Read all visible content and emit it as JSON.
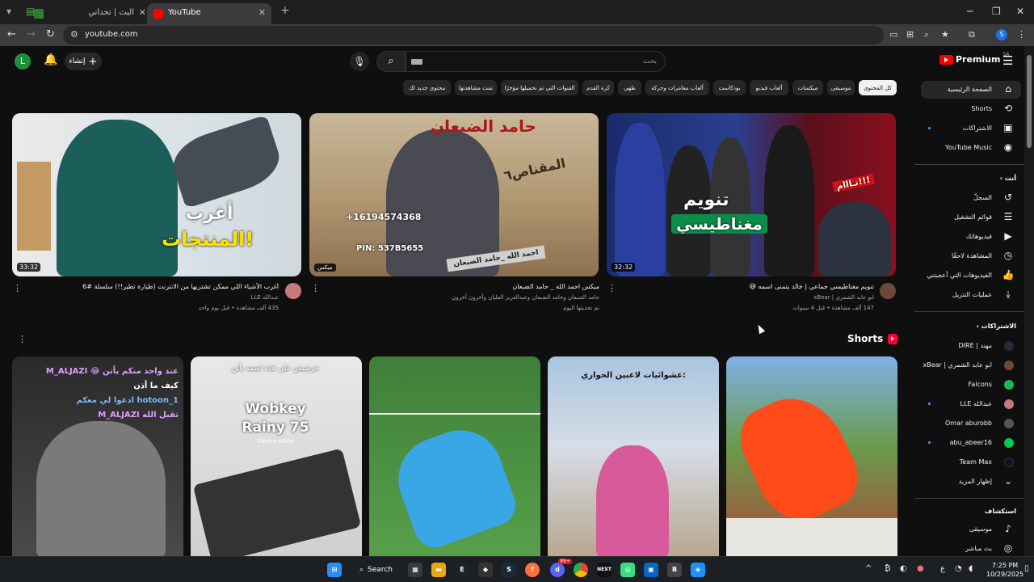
{
  "browser": {
    "tabs": [
      {
        "title": "البث | تحداني",
        "active": false
      },
      {
        "title": "YouTube",
        "active": true
      }
    ],
    "url": "youtube.com",
    "profile_initial": "S"
  },
  "header": {
    "avatar_initial": "L",
    "create_label": "إنشاء",
    "search_placeholder": "بحث",
    "logo_word": "Premium",
    "logo_region": "SA"
  },
  "chips": [
    "كل المحتوى",
    "موسيقى",
    "ميكسات",
    "ألعاب فيديو",
    "بودكاست",
    "ألعاب مغامرات وحركة",
    "طهي",
    "كرة القدم",
    "القنوات التي تم تحميلها مؤخرًا",
    "تمت مشاهدتها",
    "محتوى جديد لك"
  ],
  "videos": [
    {
      "title": "أغرب الأشياء اللي ممكن تشتريها من الانترنت (طيارة تطير!!) سلسلة #6",
      "channel": "عبدالله LLE",
      "stats": "435 ألف مشاهدة • قبل يوم واحد",
      "duration": "33:32",
      "thumb_text": [
        "أغرب",
        "المنتجات!"
      ]
    },
    {
      "title": "ميكس احمد الله _ حامد الضبعان",
      "channel": "حامد الضبعان وحامد الضبعان وعبدالعزيز العليان وآخرون آخرون",
      "stats": "تم تحديثها اليوم",
      "badge": "ميكس",
      "thumb_text": [
        "حامد الضبعان",
        "المقناص٦",
        "+16194574368",
        "PIN: 537B5655",
        "احمد الله _حامد الضبعان"
      ]
    },
    {
      "title": "تنويم مغناطيسي جماعي | خالد يتمنى اسمه 😅",
      "channel": "ابو عابد الشمري | xBear",
      "stats": "147 ألف مشاهدة • قبل 4 سنوات",
      "duration": "32:32",
      "thumb_text": [
        "تنويم",
        "مغناطيسي",
        "نـااام!!!"
      ]
    }
  ],
  "shorts": {
    "heading": "Shorts",
    "items": [
      {
        "overlay": [
          "M_ALJAZI 😂 عند واحد منكم يأتن",
          "كيف ما أذن",
          "ادعوا لي معكم hotoon_1",
          "M_ALJAZI تقبل الله"
        ]
      },
      {
        "overlay": [
          "جرسيس على هذه اسمه يأتن",
          "Wobkey",
          "Rainy 75",
          "Electro white"
        ]
      },
      {
        "overlay": []
      },
      {
        "overlay": [
          "عشوائيات لاعبين الحواري:"
        ]
      },
      {
        "overlay": []
      }
    ]
  },
  "sidebar": {
    "main": [
      {
        "label": "الصفحة الرئيسية",
        "icon": "home-icon",
        "glyph": "⌂",
        "active": true
      },
      {
        "label": "Shorts",
        "icon": "shorts-icon",
        "glyph": "⟲"
      },
      {
        "label": "الاشتراكات",
        "icon": "subscriptions-icon",
        "glyph": "▣",
        "dot": true
      },
      {
        "label": "YouTube Music",
        "icon": "music-icon",
        "glyph": "◉"
      }
    ],
    "you_heading": "أنت",
    "you": [
      {
        "label": "السجلّ",
        "icon": "history-icon",
        "glyph": "↺"
      },
      {
        "label": "قوائم التشغيل",
        "icon": "playlists-icon",
        "glyph": "☰"
      },
      {
        "label": "فيديوهاتك",
        "icon": "your-videos-icon",
        "glyph": "▶"
      },
      {
        "label": "المشاهدة لاحقًا",
        "icon": "watch-later-icon",
        "glyph": "◷"
      },
      {
        "label": "الفيديوهات التي أعجبتني",
        "icon": "like-icon",
        "glyph": "👍"
      },
      {
        "label": "عمليات التنزيل",
        "icon": "download-icon",
        "glyph": "⤓"
      }
    ],
    "subs_heading": "الاشتراكات",
    "subs": [
      {
        "label": "مهند | DIRE",
        "color": "#2a2a3a"
      },
      {
        "label": "ابو عابد الشمري | xBear",
        "color": "#6b4a3a"
      },
      {
        "label": "Falcons",
        "color": "#1db954"
      },
      {
        "label": "عبدالله LLE",
        "color": "#c47a7a",
        "dot": true
      },
      {
        "label": "Omar aburobb",
        "color": "#555555"
      },
      {
        "label": "abu_abeer16",
        "color": "#00c853",
        "dot": true
      },
      {
        "label": "Team Max",
        "color": "#101030"
      },
      {
        "label": "إظهار المزيد",
        "glyph": "⌄"
      }
    ],
    "explore_heading": "استكشاف",
    "explore": [
      {
        "label": "موسيقى",
        "icon": "music-note-icon",
        "glyph": "♪"
      },
      {
        "label": "بث مباشر",
        "icon": "live-icon",
        "glyph": "◎"
      }
    ]
  },
  "taskbar": {
    "search_label": "Search",
    "time": "7:25 PM",
    "date": "10/29/2025",
    "discord_badge": "99+"
  },
  "colors": {
    "background": "#0f0f0f",
    "brand_red": "#ff0000",
    "chip_bg": "#272727",
    "link_blue": "#3ea6ff"
  }
}
